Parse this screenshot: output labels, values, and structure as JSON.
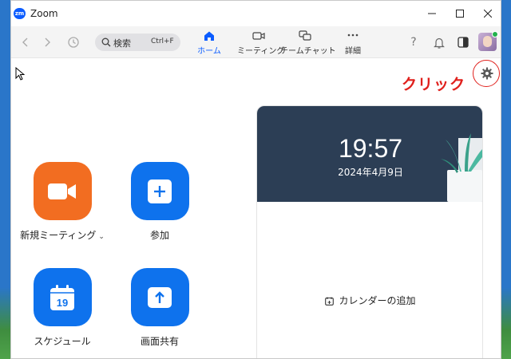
{
  "window": {
    "app_name": "Zoom",
    "logo_text": "zm"
  },
  "toolbar": {
    "search_label": "検索",
    "search_shortcut": "Ctrl+F",
    "tabs": [
      {
        "label": "ホーム",
        "icon": "home-icon",
        "active": true
      },
      {
        "label": "ミーティング",
        "icon": "video-camera-icon",
        "active": false
      },
      {
        "label": "チームチャット",
        "icon": "chat-bubbles-icon",
        "active": false
      },
      {
        "label": "詳細",
        "icon": "more-icon",
        "active": false
      }
    ],
    "help_label": "?"
  },
  "annotation": {
    "text": "クリック",
    "color": "#e0201c"
  },
  "actions": [
    {
      "label": "新規ミーティング",
      "icon": "video-camera-icon",
      "color": "#f26d21",
      "has_dropdown": true
    },
    {
      "label": "参加",
      "icon": "plus-icon",
      "color": "#0e72ed"
    },
    {
      "label": "スケジュール",
      "icon": "calendar-icon",
      "color": "#0e72ed",
      "calendar_day": "19"
    },
    {
      "label": "画面共有",
      "icon": "upload-arrow-icon",
      "color": "#0e72ed"
    }
  ],
  "calendar_card": {
    "time": "19:57",
    "date": "2024年4月9日",
    "add_calendar_label": "カレンダーの追加"
  },
  "colors": {
    "accent": "#0b5cff",
    "banner": "#2c3e55"
  }
}
